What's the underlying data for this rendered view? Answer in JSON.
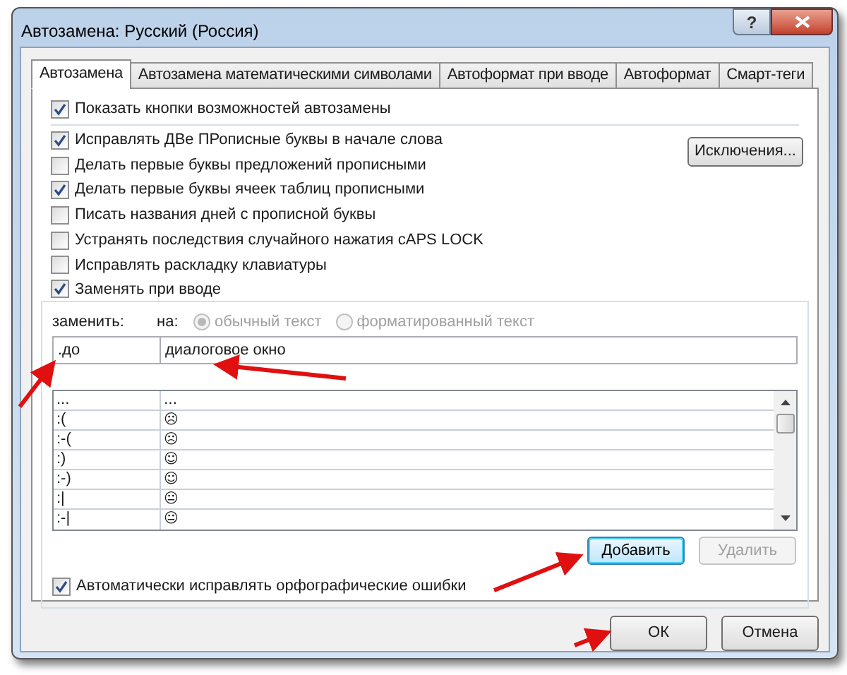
{
  "window": {
    "title": "Автозамена: Русский (Россия)",
    "help": "?"
  },
  "tabs": [
    {
      "label": "Автозамена",
      "selected": true
    },
    {
      "label": "Автозамена математическими символами",
      "selected": false
    },
    {
      "label": "Автоформат при вводе",
      "selected": false
    },
    {
      "label": "Автоформат",
      "selected": false
    },
    {
      "label": "Смарт-теги",
      "selected": false
    }
  ],
  "show_buttons": {
    "label": "Показать кнопки возможностей автозамены",
    "checked": true
  },
  "options": [
    {
      "label": "Исправлять ДВе ПРописные буквы в начале слова",
      "checked": true
    },
    {
      "label": "Делать первые буквы предложений прописными",
      "checked": false
    },
    {
      "label": "Делать первые буквы ячеек таблиц прописными",
      "checked": true
    },
    {
      "label": "Писать названия дней с прописной буквы",
      "checked": false
    },
    {
      "label": "Устранять последствия случайного нажатия cAPS LOCK",
      "checked": false
    },
    {
      "label": "Исправлять раскладку клавиатуры",
      "checked": false
    }
  ],
  "exceptions_button": "Исключения...",
  "replace_group": {
    "checkbox": {
      "label": "Заменять при вводе",
      "checked": true
    },
    "replace_label": "заменить:",
    "with_label": "на:",
    "radios": [
      {
        "label": "обычный текст",
        "selected": true,
        "disabled": true
      },
      {
        "label": "форматированный текст",
        "selected": false,
        "disabled": true
      }
    ],
    "replace_value": ".до",
    "with_value": "диалоговое окно",
    "rows": [
      {
        "from": "...",
        "to": "..."
      },
      {
        "from": ":(",
        "to": "☹"
      },
      {
        "from": ":-(",
        "to": "☹"
      },
      {
        "from": ":)",
        "to": "☺"
      },
      {
        "from": ":-)",
        "to": "☺"
      },
      {
        "from": ":|",
        "to": "😐"
      },
      {
        "from": ":-|",
        "to": "😐"
      }
    ],
    "buttons": [
      {
        "label": "Добавить",
        "disabled": false,
        "focused": true
      },
      {
        "label": "Удалить",
        "disabled": true,
        "focused": false
      }
    ],
    "spelling": {
      "label": "Автоматически исправлять орфографические ошибки",
      "checked": true
    }
  },
  "dialog_buttons": [
    {
      "label": "ОК"
    },
    {
      "label": "Отмена"
    }
  ]
}
